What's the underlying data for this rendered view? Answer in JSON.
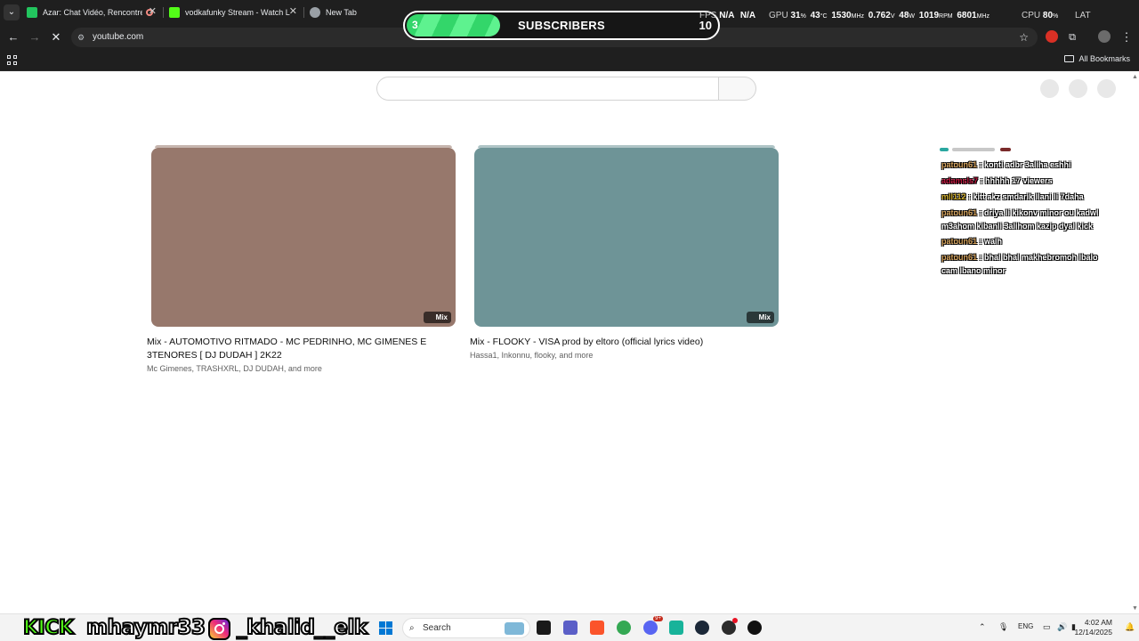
{
  "browser": {
    "tabs": [
      {
        "title": "Azar: Chat Vidéo, Rencontre",
        "favicon_color": "#22c55e",
        "recording": true
      },
      {
        "title": "vodkafunky Stream - Watch Liv",
        "favicon_color": "#53fc18"
      },
      {
        "title": "New Tab",
        "favicon_color": "#9aa0a6"
      }
    ],
    "url": "youtube.com",
    "bookmarks_label": "All Bookmarks"
  },
  "overlay": {
    "sub_goal": {
      "label": "SUBSCRIBERS",
      "current": "3",
      "target": "10",
      "progress": 0.3
    },
    "osd": {
      "fps_label": "FPS",
      "fps": "N/A",
      "fps2": "N/A",
      "gpu_label": "GPU",
      "gpu_load": "31",
      "gpu_load_unit": "%",
      "gpu_temp": "43",
      "gpu_temp_unit": "°C",
      "gpu_clock": "1530",
      "gpu_clock_unit": "MHz",
      "gpu_volt": "0.762",
      "gpu_volt_unit": "V",
      "gpu_power": "48",
      "gpu_power_unit": "W",
      "fan": "1019",
      "fan_unit": "RPM",
      "mem_clock": "6801",
      "mem_clock_unit": "MHz",
      "cpu_label": "CPU",
      "cpu_load": "80",
      "cpu_load_unit": "%",
      "lat_label": "LAT"
    }
  },
  "youtube": {
    "videos": [
      {
        "title": "Mix - AUTOMOTIVO RITMADO - MC PEDRINHO, MC GIMENES E 3TENORES [ DJ DUDAH ] 2K22",
        "meta": "Mc Gimenes, TRASHXRL, DJ DUDAH, and more",
        "badge": "Mix",
        "thumb_color": "#97786c"
      },
      {
        "title": "Mix - FLOOKY - VISA prod by eltoro (official lyrics video)",
        "meta": "Hassa1, Inkonnu, flooky, and more",
        "badge": "Mix",
        "thumb_color": "#6e9497"
      }
    ]
  },
  "chat": {
    "messages": [
      {
        "user": "patoun61",
        "text": ": konti adbr 3aliha eshhi",
        "color": "#d6a35c"
      },
      {
        "user": "adamsls7",
        "text": ": hhhhh 17 viewers",
        "color": "#c0143c"
      },
      {
        "user": "mll112",
        "text": ": kitt akz smdarik llani li 7daha",
        "color": "#d8b430"
      },
      {
        "user": "patoun61",
        "text": ": driya li kikonv minor ou kadwl m3ahom kibanli 3alihom kazip dyal kick",
        "color": "#d6a35c"
      },
      {
        "user": "patoun61",
        "text": ": walh",
        "color": "#d6a35c"
      },
      {
        "user": "patoun61",
        "text": ": bhal bhal makhebromoh lbalo cam lbano minor",
        "color": "#d6a35c"
      }
    ]
  },
  "stream_brand": {
    "platform": "KICK",
    "kick_handle": "mhaymr33",
    "instagram_handle": "_khalid__elk"
  },
  "taskbar": {
    "search_placeholder": "Search",
    "lang": "ENG",
    "time": "4:02 AM",
    "date": "12/14/2025",
    "notification_count": "9+"
  }
}
